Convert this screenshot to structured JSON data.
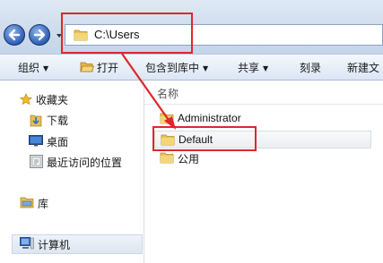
{
  "address_bar": {
    "path": "C:\\Users"
  },
  "toolbar": {
    "organize": "组织",
    "open": "打开",
    "include_in_library": "包含到库中",
    "share": "共享",
    "burn": "刻录",
    "new_folder": "新建文"
  },
  "nav_pane": {
    "favorites": "收藏夹",
    "favorites_items": [
      "下载",
      "桌面",
      "最近访问的位置"
    ],
    "libraries": "库",
    "computer": "计算机"
  },
  "content": {
    "column_name": "名称",
    "folders": [
      "Administrator",
      "Default",
      "公用"
    ]
  },
  "annotation": {
    "highlight_color": "#e0262b"
  }
}
